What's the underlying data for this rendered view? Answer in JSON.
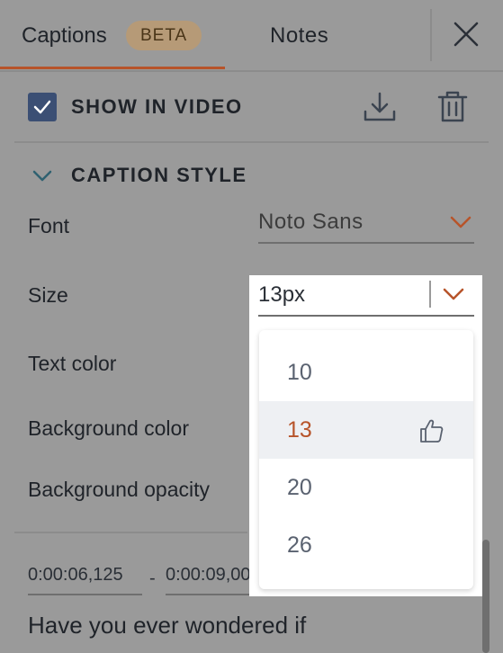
{
  "tabs": {
    "captions_label": "Captions",
    "captions_badge": "BETA",
    "notes_label": "Notes"
  },
  "show_in_video": {
    "label": "SHOW IN VIDEO",
    "checked": true
  },
  "caption_style": {
    "title": "CAPTION STYLE",
    "font_label": "Font",
    "font_value": "Noto Sans",
    "size_label": "Size",
    "size_value": "13px",
    "text_color_label": "Text color",
    "background_color_label": "Background color",
    "background_opacity_label": "Background opacity"
  },
  "size_dropdown": {
    "options": [
      "10",
      "13",
      "20",
      "26"
    ],
    "selected": "13"
  },
  "caption_item": {
    "start": "0:00:06,125",
    "separator": "-",
    "end": "0:00:09,00",
    "text": "Have you ever wondered if"
  },
  "colors": {
    "accent": "#b7542a",
    "checkbox": "#3b4f74",
    "badge_bg": "#b69a77"
  }
}
